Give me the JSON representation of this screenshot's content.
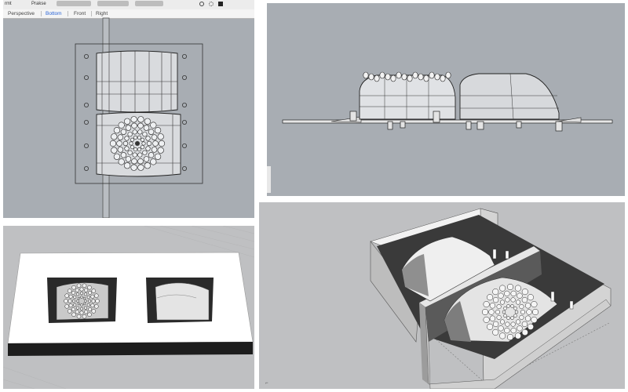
{
  "toolbar": {
    "left_label": "rmt",
    "menu_label": "Prakse",
    "buttons": [
      "",
      "",
      ""
    ],
    "icons": [
      "clock-icon",
      "gear-icon",
      "square-icon"
    ]
  },
  "viewport_tabs": {
    "items": [
      "Perspective",
      "Bottom",
      "Front",
      "Right"
    ],
    "active": "Bottom"
  },
  "colors": {
    "viewport_bg": "#a8adb3",
    "shaded_bg": "#bfc0c2",
    "active_tab": "#2a64d6"
  }
}
